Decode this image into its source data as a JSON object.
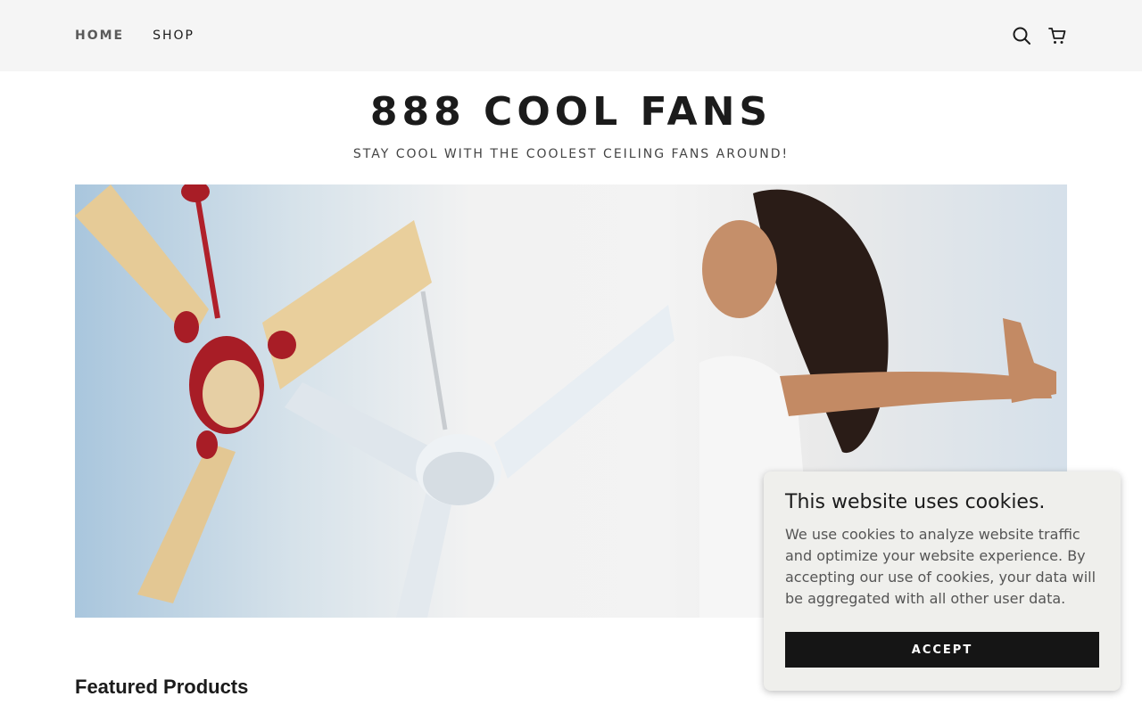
{
  "nav": {
    "items": [
      {
        "label": "HOME"
      },
      {
        "label": "SHOP"
      }
    ],
    "icons": [
      "search-icon",
      "cart-icon"
    ]
  },
  "site": {
    "title": "888 COOL FANS",
    "tagline": "STAY COOL WITH THE COOLEST CEILING FANS AROUND!"
  },
  "hero": {
    "image": "ceiling fans and woman with open arms"
  },
  "featured": {
    "title": "Featured Products"
  },
  "cookie_banner": {
    "title": "This website uses cookies.",
    "body": "We use cookies to analyze website traffic and optimize your website experience. By accepting our use of cookies, your data will be aggregated with all other user data.",
    "accept_label": "ACCEPT"
  }
}
